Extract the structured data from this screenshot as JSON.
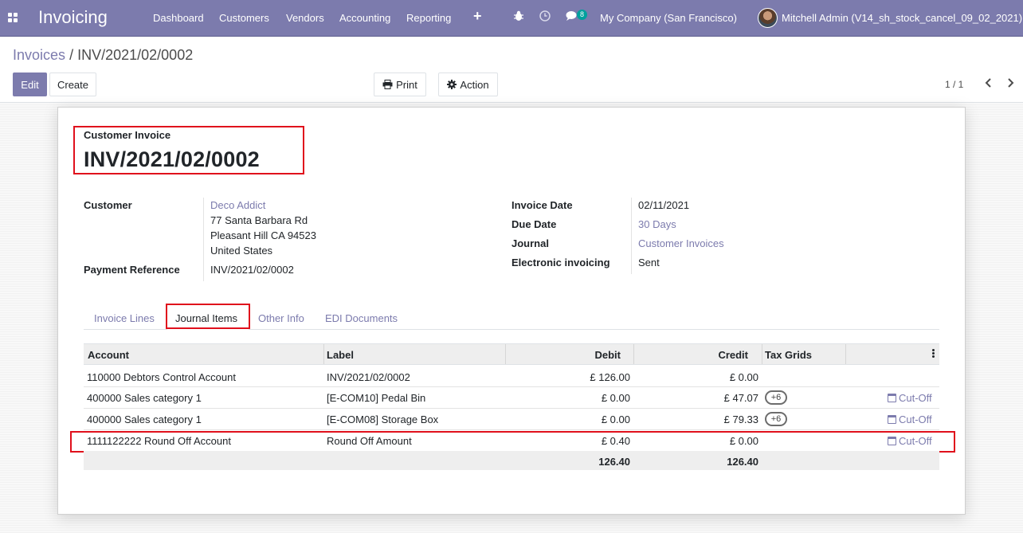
{
  "navbar": {
    "app_name": "Invoicing",
    "menu": [
      "Dashboard",
      "Customers",
      "Vendors",
      "Accounting",
      "Reporting"
    ],
    "plus_icon": "+",
    "chat_badge": "8",
    "company": "My Company (San Francisco)",
    "user": "Mitchell Admin (V14_sh_stock_cancel_09_02_2021)",
    "color": "#7c7bad"
  },
  "breadcrumb": {
    "parent": "Invoices",
    "separator": "/",
    "current": "INV/2021/02/0002"
  },
  "buttons": {
    "edit": "Edit",
    "create": "Create",
    "print": "Print",
    "action": "Action"
  },
  "pager": {
    "value": "1 / 1"
  },
  "invoice": {
    "type": "Customer Invoice",
    "name": "INV/2021/02/0002"
  },
  "fields_left": {
    "customer_label": "Customer",
    "customer_name": "Deco Addict",
    "address_line1": "77 Santa Barbara Rd",
    "address_line2": "Pleasant Hill CA 94523",
    "address_line3": "United States",
    "payment_ref_label": "Payment Reference",
    "payment_ref_value": "INV/2021/02/0002"
  },
  "fields_right": {
    "invoice_date_label": "Invoice Date",
    "invoice_date_value": "02/11/2021",
    "due_date_label": "Due Date",
    "due_date_value": "30 Days",
    "journal_label": "Journal",
    "journal_value": "Customer Invoices",
    "edi_label": "Electronic invoicing",
    "edi_value": "Sent"
  },
  "tabs": {
    "invoice_lines": "Invoice Lines",
    "journal_items": "Journal Items",
    "other_info": "Other Info",
    "edi_documents": "EDI Documents"
  },
  "table": {
    "headers": {
      "account": "Account",
      "label": "Label",
      "debit": "Debit",
      "credit": "Credit",
      "tax_grids": "Tax Grids"
    },
    "rows": [
      {
        "account": "110000 Debtors Control Account",
        "label": "INV/2021/02/0002",
        "debit": "£ 126.00",
        "credit": "£ 0.00",
        "tax": "",
        "action": ""
      },
      {
        "account": "400000 Sales category 1",
        "label": "[E-COM10] Pedal Bin",
        "debit": "£ 0.00",
        "credit": "£ 47.07",
        "tax": "+6",
        "action": "Cut-Off"
      },
      {
        "account": "400000 Sales category 1",
        "label": "[E-COM08] Storage Box",
        "debit": "£ 0.00",
        "credit": "£ 79.33",
        "tax": "+6",
        "action": "Cut-Off"
      },
      {
        "account": "1111122222 Round Off Account",
        "label": "Round Off Amount",
        "debit": "£ 0.40",
        "credit": "£ 0.00",
        "tax": "",
        "action": "Cut-Off"
      }
    ],
    "totals": {
      "debit": "126.40",
      "credit": "126.40"
    }
  }
}
